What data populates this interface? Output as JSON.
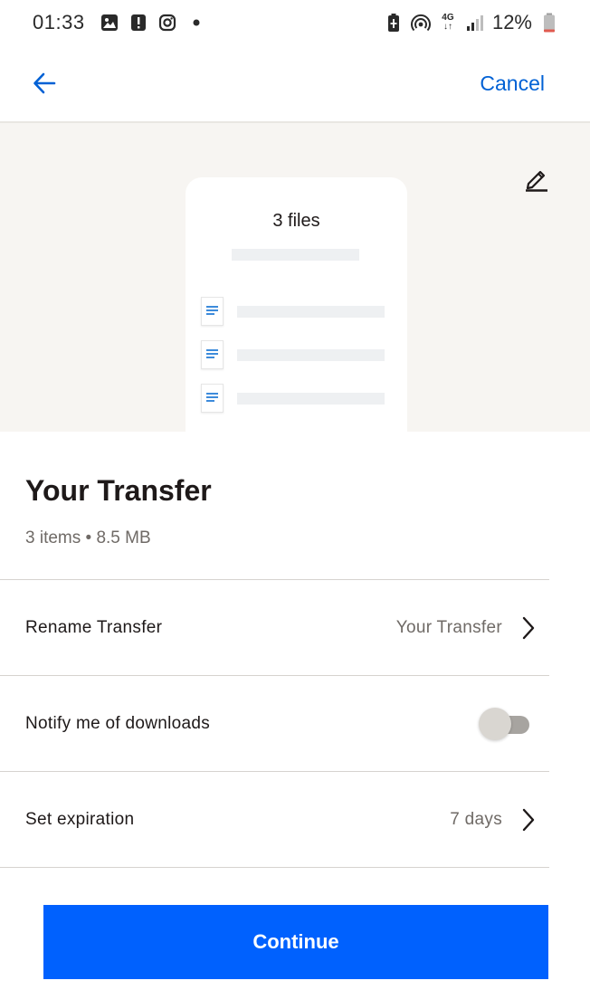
{
  "status_bar": {
    "time": "01:33",
    "network_top": "4G",
    "network_bottom": "↓↑",
    "battery": "12%",
    "icons": [
      "gallery-icon",
      "alert-icon",
      "instagram-icon",
      "dot-icon",
      "battery-saver-icon",
      "hotspot-icon",
      "signal-icon",
      "battery-icon"
    ]
  },
  "app_bar": {
    "back_icon": "arrow-left-icon",
    "cancel_label": "Cancel"
  },
  "preview": {
    "edit_icon": "pencil-icon",
    "card_title": "3 files",
    "file_icon": "document-icon",
    "file_count": 3
  },
  "transfer": {
    "title": "Your Transfer",
    "meta": "3 items • 8.5 MB"
  },
  "settings": {
    "rename": {
      "label": "Rename Transfer",
      "value": "Your Transfer"
    },
    "notify": {
      "label": "Notify me of downloads",
      "enabled": false
    },
    "expiration": {
      "label": "Set expiration",
      "value": "7 days"
    }
  },
  "actions": {
    "continue_label": "Continue"
  },
  "colors": {
    "accent": "#0061fe",
    "link": "#0061d5",
    "preview_bg": "#f7f5f2"
  }
}
